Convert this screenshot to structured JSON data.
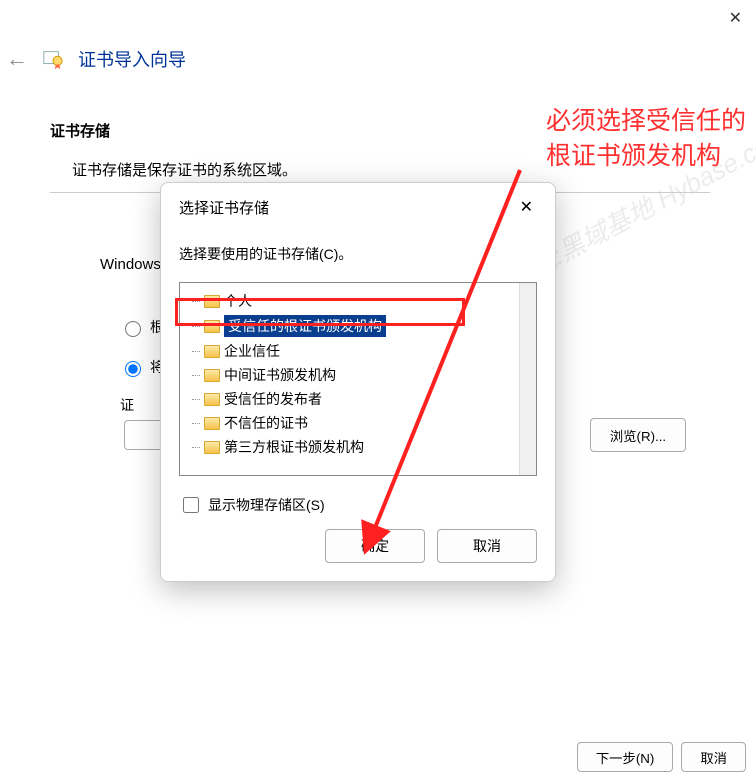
{
  "wizard": {
    "title": "证书导入向导",
    "section_title": "证书存储",
    "section_desc": "证书存储是保存证书的系统区域。",
    "windows_label": "Windows",
    "radio_auto_label": "根据",
    "radio_place_label": "将所",
    "store_partial_label": "证",
    "browse_label": "浏览(R)...",
    "next_label": "下一步(N)",
    "cancel_label": "取消"
  },
  "dialog": {
    "title": "选择证书存储",
    "instruction": "选择要使用的证书存储(C)。",
    "tree_items": [
      "个人",
      "受信任的根证书颁发机构",
      "企业信任",
      "中间证书颁发机构",
      "受信任的发布者",
      "不信任的证书",
      "第三方根证书颁发机构"
    ],
    "selected_index": 1,
    "show_physical_label": "显示物理存储区(S)",
    "ok_label": "确定",
    "cancel_label": "取消"
  },
  "annotation": {
    "line1": "必须选择受信任的",
    "line2": "根证书颁发机构"
  },
  "watermark": "欢迎收藏:黑域基地 Hybase.com"
}
